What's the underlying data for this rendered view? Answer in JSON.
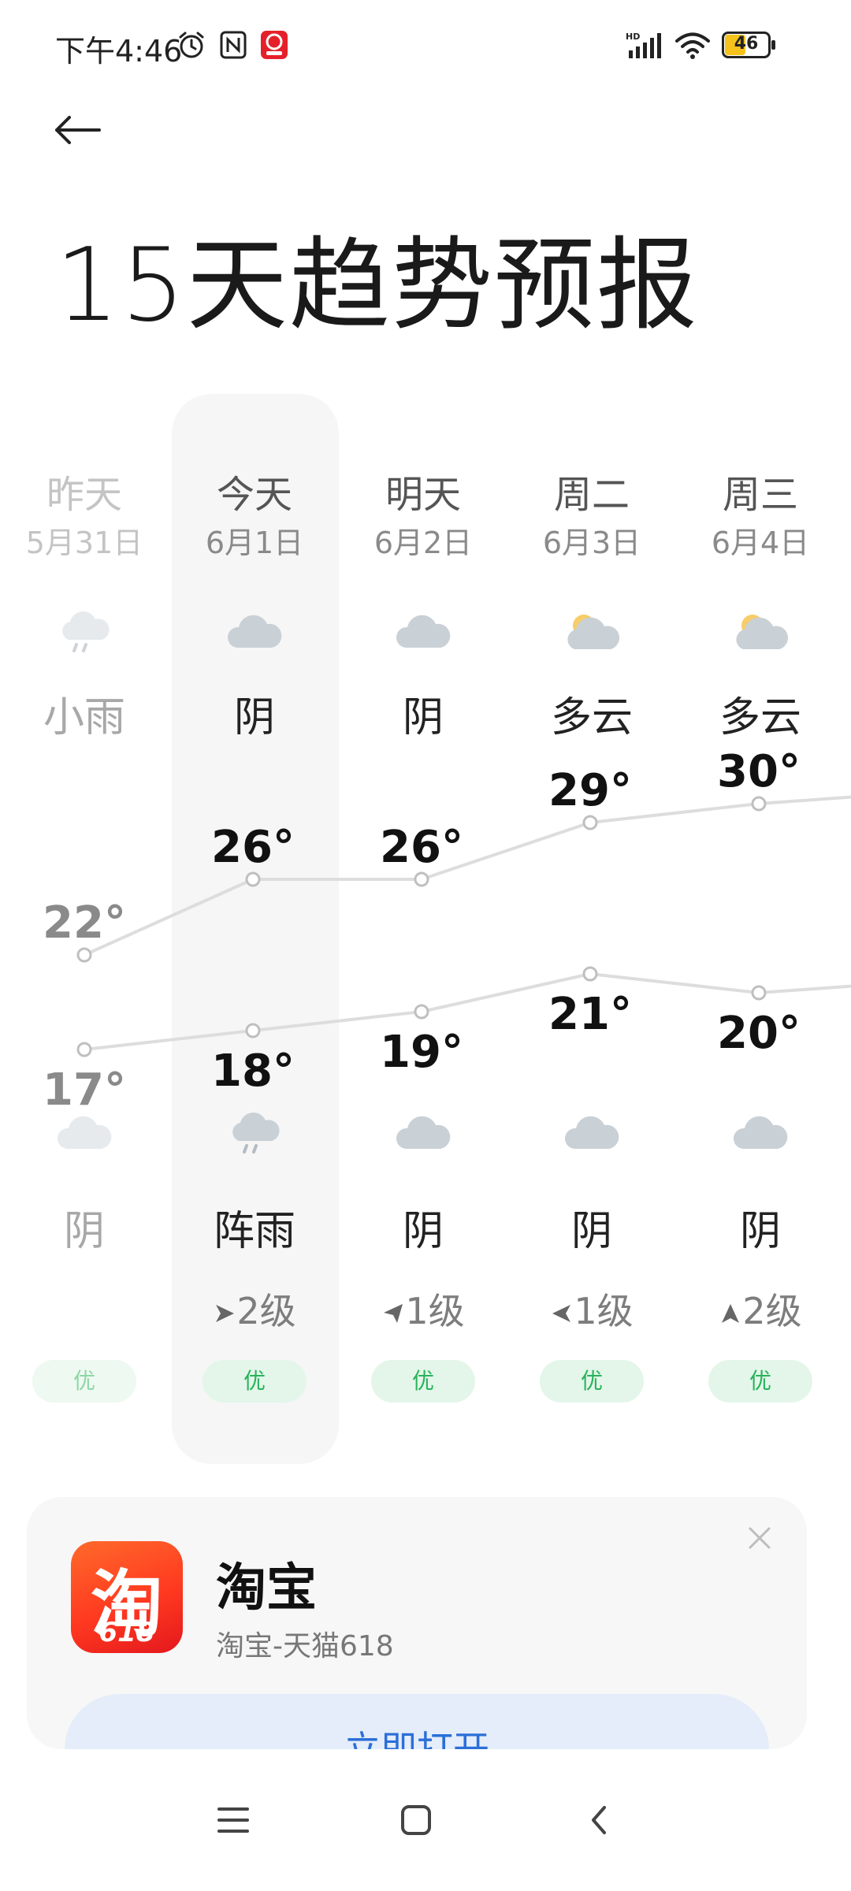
{
  "status_bar": {
    "time": "下午4:46",
    "battery": "46",
    "icons": [
      "alarm-icon",
      "nfc-icon",
      "taobao-notification-icon",
      "hd-signal-icon",
      "wifi-icon",
      "battery-icon"
    ]
  },
  "header": {
    "back_icon": "arrow-left-icon",
    "title": "15天趋势预报"
  },
  "forecast": {
    "days": [
      {
        "name": "昨天",
        "date": "5月31日",
        "day_weather": "小雨",
        "day_icon": "rain-icon",
        "night_weather": "阴",
        "night_icon": "overcast-icon",
        "wind": "",
        "aqi": "优",
        "high": "22°",
        "low": "17°"
      },
      {
        "name": "今天",
        "date": "6月1日",
        "day_weather": "阴",
        "day_icon": "overcast-icon",
        "night_weather": "阵雨",
        "night_icon": "shower-icon",
        "wind": "2级",
        "wind_icon": "wind-east-icon",
        "aqi": "优",
        "high": "26°",
        "low": "18°"
      },
      {
        "name": "明天",
        "date": "6月2日",
        "day_weather": "阴",
        "day_icon": "overcast-icon",
        "night_weather": "阴",
        "night_icon": "overcast-icon",
        "wind": "1级",
        "wind_icon": "wind-northeast-icon",
        "aqi": "优",
        "high": "26°",
        "low": "19°"
      },
      {
        "name": "周二",
        "date": "6月3日",
        "day_weather": "多云",
        "day_icon": "partly-cloudy-icon",
        "night_weather": "阴",
        "night_icon": "overcast-icon",
        "wind": "1级",
        "wind_icon": "wind-west-icon",
        "aqi": "优",
        "high": "29°",
        "low": "21°"
      },
      {
        "name": "周三",
        "date": "6月4日",
        "day_weather": "多云",
        "day_icon": "partly-cloudy-icon",
        "night_weather": "阴",
        "night_icon": "overcast-icon",
        "wind": "2级",
        "wind_icon": "wind-north-icon",
        "aqi": "优",
        "high": "30°",
        "low": "20°"
      }
    ],
    "colors": {
      "aqi_good_bg": "#e3f6e9",
      "aqi_good_text": "#27b35a",
      "trend_line": "#dddddd"
    }
  },
  "chart_data": {
    "type": "line",
    "categories": [
      "昨天",
      "今天",
      "明天",
      "周二",
      "周三"
    ],
    "series": [
      {
        "values": [
          22,
          26,
          26,
          29,
          30
        ]
      },
      {
        "values": [
          17,
          18,
          19,
          21,
          20
        ]
      }
    ]
  },
  "ad": {
    "title": "淘宝",
    "subtitle": "淘宝-天猫618",
    "logo_glyph": "淘",
    "logo_number": "618",
    "button_label": "立即打开",
    "close_icon": "close-icon"
  },
  "nav_bar": {
    "icons": [
      "menu-icon",
      "home-icon",
      "back-chevron-icon"
    ]
  }
}
